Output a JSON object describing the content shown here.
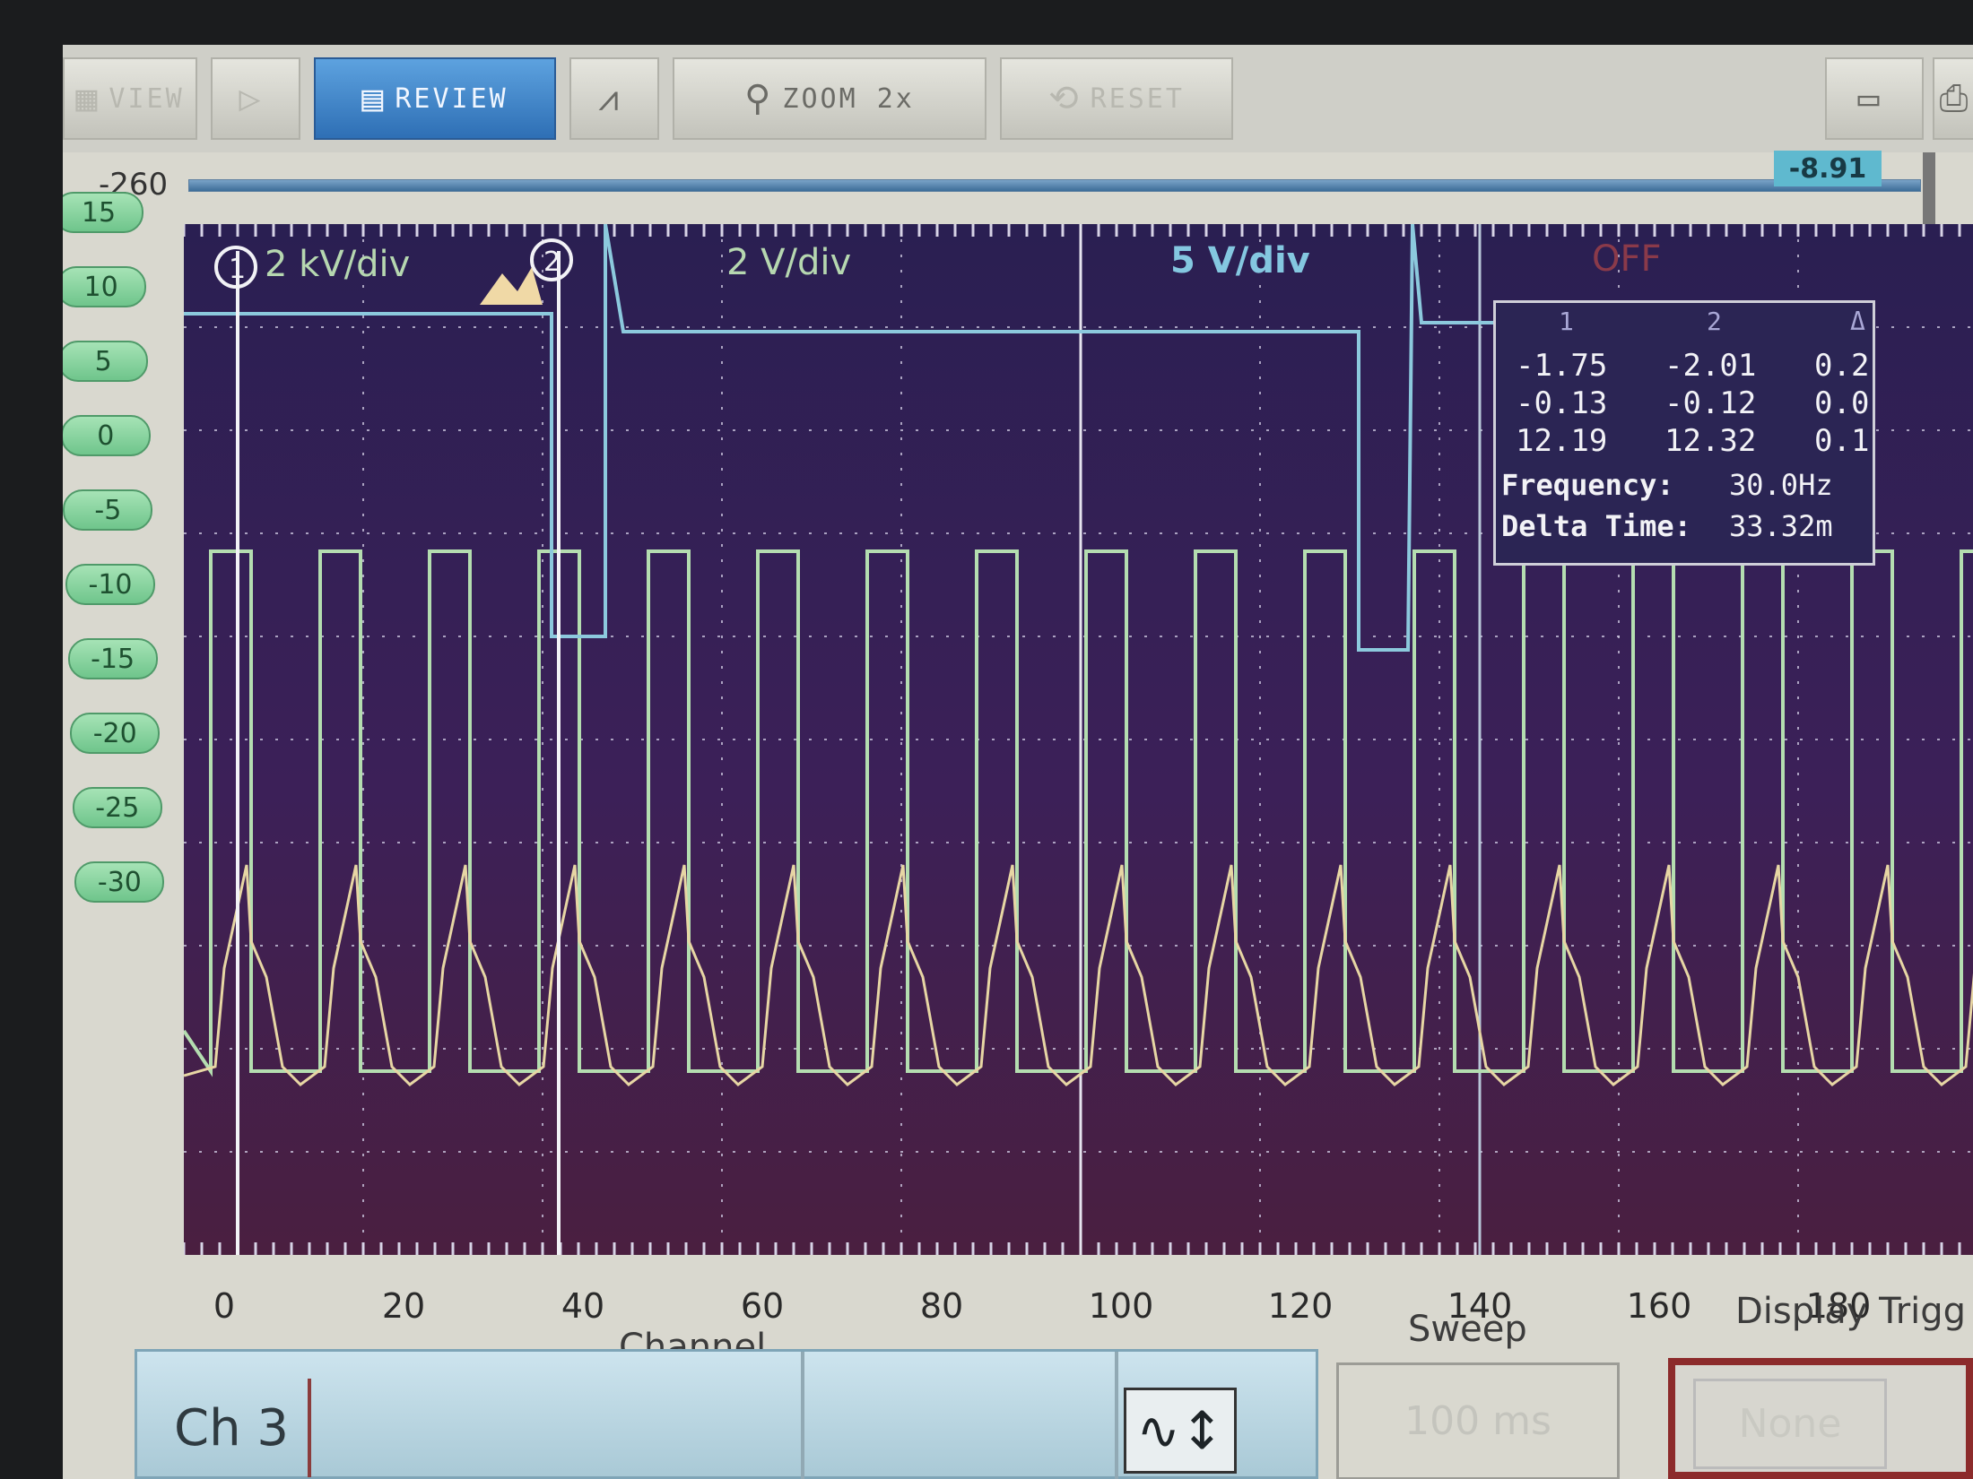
{
  "toolbar": {
    "buttons": [
      {
        "label": "VIEW",
        "icon": "view-icon"
      },
      {
        "label": "",
        "icon": "play-icon"
      },
      {
        "label": "REVIEW",
        "icon": "waveform-review-icon"
      },
      {
        "label": "",
        "icon": "add-marker-icon"
      },
      {
        "label": "ZOOM 2x",
        "icon": "magnifier-icon"
      },
      {
        "label": "RESET",
        "icon": "reset-icon"
      }
    ],
    "right_icons": [
      "folder-icon",
      "printer-icon"
    ]
  },
  "slider": {
    "min": "-260",
    "value": "-8.91"
  },
  "y_axis": {
    "ticks": [
      "15",
      "10",
      "5",
      "0",
      "-5",
      "-10",
      "-15",
      "-20",
      "-25",
      "-30"
    ]
  },
  "scales": {
    "ch1": "2 kV/div",
    "ch2": "2 V/div",
    "ch3": "5 V/div",
    "ch4": "OFF"
  },
  "cursors": {
    "c1": "1",
    "c2": "2"
  },
  "readout": {
    "headers": [
      "1",
      "2",
      "Δ"
    ],
    "rows": [
      [
        "-1.75",
        "-2.01",
        "0.2"
      ],
      [
        "-0.13",
        "-0.12",
        "0.0"
      ],
      [
        "12.19",
        "12.32",
        "0.1"
      ]
    ],
    "frequency_label": "Frequency:",
    "frequency_value": "30.0Hz",
    "delta_label": "Delta Time:",
    "delta_value": "33.32m"
  },
  "x_axis": {
    "ticks": [
      "0",
      "20",
      "40",
      "60",
      "80",
      "100",
      "120",
      "140",
      "160",
      "180",
      "20"
    ]
  },
  "labels": {
    "channel": "Channel",
    "sweep": "Sweep",
    "display_trigger": "Display Trigg"
  },
  "bottom": {
    "channel": "Ch 3",
    "sweep_value": "100 ms",
    "trigger_value": "None"
  },
  "colors": {
    "ch1": "#e7d6a4",
    "ch2": "#b4ddb0",
    "ch3": "#8cc9dd"
  }
}
